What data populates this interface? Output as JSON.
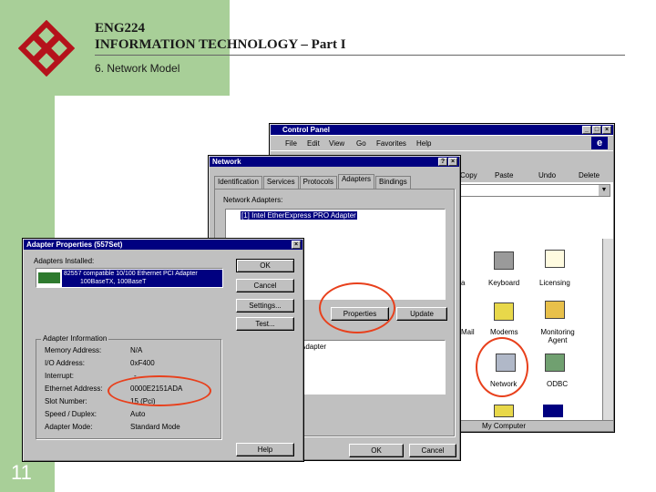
{
  "slide": {
    "course_code": "ENG224",
    "course_title": "INFORMATION TECHNOLOGY – Part I",
    "section": "6. Network Model",
    "page_number": "11",
    "accent_color": "#a8cf98",
    "logo_color": "#b5121b"
  },
  "control_panel": {
    "title": "Control Panel",
    "menu": [
      "File",
      "Edit",
      "View",
      "Go",
      "Favorites",
      "Help"
    ],
    "toolbar": [
      "Copy",
      "Paste",
      "Undo",
      "Delete"
    ],
    "icons": [
      {
        "label": "Keyboard",
        "icon": "keyboard-icon"
      },
      {
        "label": "Licensing",
        "icon": "licensing-icon"
      },
      {
        "label": "Modems",
        "icon": "modems-icon"
      },
      {
        "label": "Monitoring Agent",
        "icon": "monitoring-agent-icon"
      },
      {
        "label": "Network",
        "icon": "network-icon"
      },
      {
        "label": "ODBC",
        "icon": "odbc-icon"
      }
    ],
    "partial_labels": [
      "Mail",
      "a"
    ],
    "status": "My Computer"
  },
  "network": {
    "title": "Network",
    "tabs": [
      "Identification",
      "Services",
      "Protocols",
      "Adapters",
      "Bindings"
    ],
    "active_tab": "Adapters",
    "list_label": "Network Adapters:",
    "adapter_item": "[1] Intel EtherExpress PRO Adapter",
    "buttons": [
      "Properties",
      "Update"
    ],
    "info_text": "Adapter"
  },
  "adapter_props": {
    "title": "Adapter Properties (557Set)",
    "installed_label": "Adapters Installed:",
    "installed_item_line1": "82557 compatible 10/100 Ethernet PCI Adapter",
    "installed_item_line2": "100BaseTX, 100BaseT",
    "buttons": [
      "OK",
      "Cancel",
      "Settings...",
      "Test..."
    ],
    "info_group": "Adapter Information",
    "rows": [
      {
        "label": "Memory Address:",
        "value": "N/A"
      },
      {
        "label": "I/O Address:",
        "value": "0xF400"
      },
      {
        "label": "Interrupt:",
        "value": "-"
      },
      {
        "label": "Ethernet Address:",
        "value": "0000E2151ADA"
      },
      {
        "label": "Slot Number:",
        "value": "15 (Pci)"
      },
      {
        "label": "Speed / Duplex:",
        "value": "Auto"
      },
      {
        "label": "Adapter Mode:",
        "value": "Standard Mode"
      }
    ],
    "help_button": "Help"
  },
  "network_footer": {
    "ok": "OK",
    "cancel": "Cancel"
  },
  "highlight_color": "#e8401c"
}
